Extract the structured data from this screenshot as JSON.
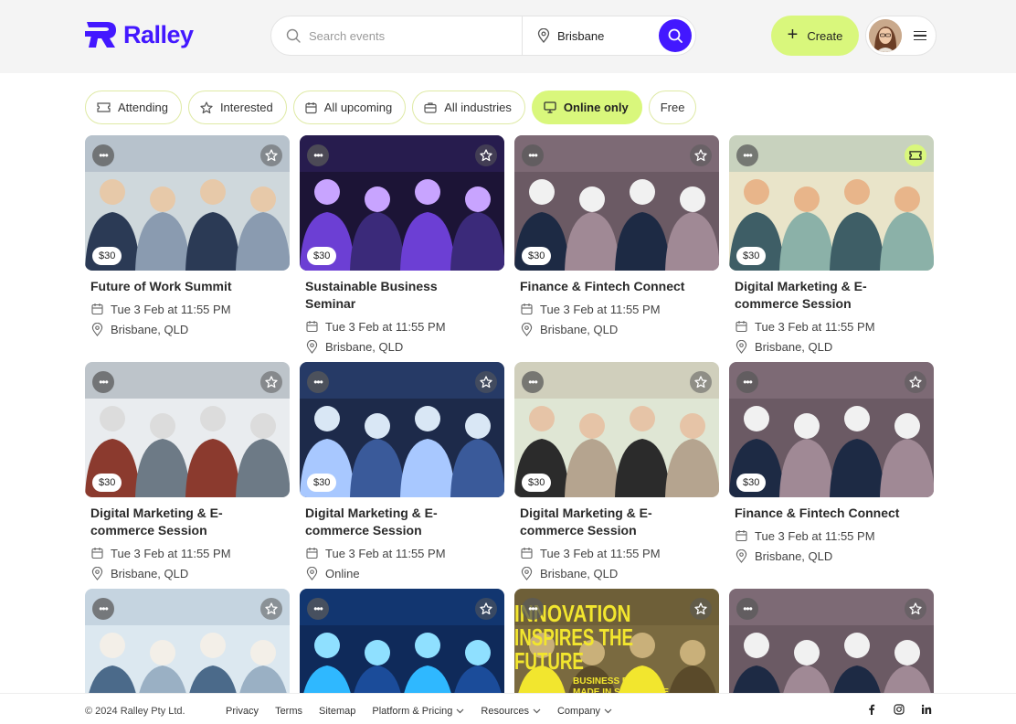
{
  "brand": {
    "name": "Ralley",
    "color": "#4318ff",
    "accent": "#d9f77c"
  },
  "header": {
    "search_placeholder": "Search events",
    "location": "Brisbane",
    "create_label": "Create"
  },
  "filters": [
    {
      "label": "Attending",
      "icon": "ticket-icon",
      "active": false
    },
    {
      "label": "Interested",
      "icon": "star-icon",
      "active": false
    },
    {
      "label": "All upcoming",
      "icon": "calendar-icon",
      "active": false
    },
    {
      "label": "All industries",
      "icon": "briefcase-icon",
      "active": false
    },
    {
      "label": "Online only",
      "icon": "monitor-icon",
      "active": true
    },
    {
      "label": "Free",
      "icon": "",
      "active": false
    }
  ],
  "events": [
    {
      "title": "Future of Work Summit",
      "price": "$30",
      "date": "Tue 3 Feb at 11:55 PM",
      "location": "Brisbane, QLD",
      "status_icon": "star-icon"
    },
    {
      "title": "Sustainable Business Seminar",
      "price": "$30",
      "date": "Tue 3 Feb at 11:55 PM",
      "location": "Brisbane, QLD",
      "status_icon": "star-icon"
    },
    {
      "title": "Finance & Fintech Connect",
      "price": "$30",
      "date": "Tue 3 Feb at 11:55 PM",
      "location": "Brisbane, QLD",
      "status_icon": "star-icon"
    },
    {
      "title": "Digital Marketing & E-commerce Session",
      "price": "$30",
      "date": "Tue 3 Feb at 11:55 PM",
      "location": "Brisbane, QLD",
      "status_icon": "ticket-icon"
    },
    {
      "title": "Digital Marketing & E-commerce Session",
      "price": "$30",
      "date": "Tue 3 Feb at 11:55 PM",
      "location": "Brisbane, QLD",
      "status_icon": "star-icon"
    },
    {
      "title": "Digital Marketing & E-commerce Session",
      "price": "$30",
      "date": "Tue 3 Feb at 11:55 PM",
      "location": "Online",
      "status_icon": "star-icon"
    },
    {
      "title": "Digital Marketing & E-commerce Session",
      "price": "$30",
      "date": "Tue 3 Feb at 11:55 PM",
      "location": "Brisbane, QLD",
      "status_icon": "star-icon"
    },
    {
      "title": "Finance & Fintech Connect",
      "price": "$30",
      "date": "Tue 3 Feb at 11:55 PM",
      "location": "Brisbane, QLD",
      "status_icon": "star-icon"
    },
    {
      "title": "",
      "price": "",
      "date": "",
      "location": "",
      "status_icon": "star-icon"
    },
    {
      "title": "",
      "price": "",
      "date": "",
      "location": "",
      "status_icon": "star-icon"
    },
    {
      "title": "",
      "price": "",
      "date": "",
      "location": "",
      "status_icon": "star-icon",
      "image_text": [
        "INNOVATION",
        "INSPIRES THE FUTURE",
        "BUSINESS EVENTS",
        "MADE IN SINGAPORE"
      ]
    },
    {
      "title": "",
      "price": "",
      "date": "",
      "location": "",
      "status_icon": "star-icon"
    }
  ],
  "footer": {
    "copyright": "© 2024 Ralley Pty Ltd.",
    "links": [
      "Privacy",
      "Terms",
      "Sitemap"
    ],
    "menus": [
      "Platform & Pricing",
      "Resources",
      "Company"
    ],
    "socials": [
      "facebook-icon",
      "instagram-icon",
      "linkedin-icon"
    ]
  }
}
